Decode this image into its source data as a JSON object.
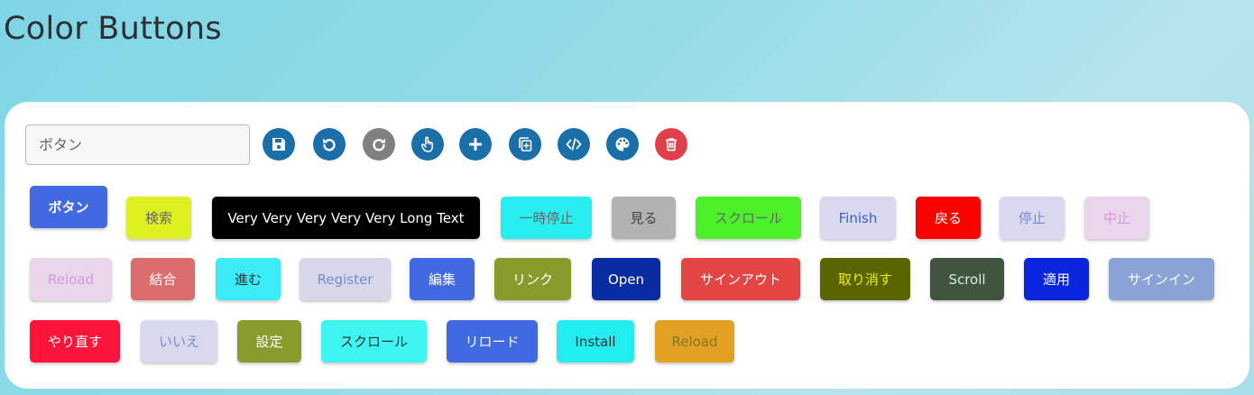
{
  "page": {
    "title": "Color Buttons"
  },
  "toolbar": {
    "input": {
      "placeholder": "ボタン",
      "value": ""
    },
    "icons": [
      {
        "name": "save-icon",
        "color": "#1a6fa8"
      },
      {
        "name": "undo-icon",
        "color": "#1a6fa8"
      },
      {
        "name": "redo-icon",
        "color": "#808080"
      },
      {
        "name": "hand-pointer-icon",
        "color": "#1a6fa8"
      },
      {
        "name": "plus-icon",
        "color": "#1a6fa8"
      },
      {
        "name": "copy-add-icon",
        "color": "#1a6fa8"
      },
      {
        "name": "code-icon",
        "color": "#1a6fa8"
      },
      {
        "name": "palette-icon",
        "color": "#1a6fa8"
      },
      {
        "name": "trash-icon",
        "color": "#e0404a"
      }
    ]
  },
  "rows": [
    [
      {
        "label": "ボタン",
        "bg": "#4169e1",
        "fg": "#ffffff",
        "bold": true
      },
      {
        "label": "検索",
        "bg": "#dff022",
        "fg": "#666666"
      },
      {
        "label": "Very Very Very Very Very Long Text",
        "bg": "#000000",
        "fg": "#ffffff"
      },
      {
        "label": "一時停止",
        "bg": "#28eeef",
        "fg": "#666666"
      },
      {
        "label": "見る",
        "bg": "#b2b2b2",
        "fg": "#444444"
      },
      {
        "label": "スクロール",
        "bg": "#4cf127",
        "fg": "#666666"
      },
      {
        "label": "Finish",
        "bg": "#d8d8ee",
        "fg": "#3a5fc8"
      },
      {
        "label": "戻る",
        "bg": "#fe0000",
        "fg": "#ffffff"
      },
      {
        "label": "停止",
        "bg": "#d8d8ee",
        "fg": "#7a8ad0"
      },
      {
        "label": "中止",
        "bg": "#ead6ea",
        "fg": "#d49ad8"
      }
    ],
    [
      {
        "label": "Reload",
        "bg": "#ead6ea",
        "fg": "#d49ad8"
      },
      {
        "label": "結合",
        "bg": "#dc6d6d",
        "fg": "#ffffff"
      },
      {
        "label": "進む",
        "bg": "#3cecf6",
        "fg": "#333333"
      },
      {
        "label": "Register",
        "bg": "#d6d8ea",
        "fg": "#7a8ad0"
      },
      {
        "label": "編集",
        "bg": "#4169e1",
        "fg": "#ffffff"
      },
      {
        "label": "リンク",
        "bg": "#8a9b2e",
        "fg": "#ffffff"
      },
      {
        "label": "Open",
        "bg": "#0a2ca1",
        "fg": "#ffffff"
      },
      {
        "label": "サインアウト",
        "bg": "#e34444",
        "fg": "#ffffff"
      },
      {
        "label": "取り消す",
        "bg": "#5b6500",
        "fg": "#f0f000"
      },
      {
        "label": "Scroll",
        "bg": "#415440",
        "fg": "#d8f0d8"
      },
      {
        "label": "適用",
        "bg": "#0b25df",
        "fg": "#ffffff"
      },
      {
        "label": "サインイン",
        "bg": "#8aa2d6",
        "fg": "#ffffff"
      }
    ],
    [
      {
        "label": "やり直す",
        "bg": "#fc143a",
        "fg": "#ffffff"
      },
      {
        "label": "いいえ",
        "bg": "#d8d8ee",
        "fg": "#7a8ad0"
      },
      {
        "label": "設定",
        "bg": "#8a9b2e",
        "fg": "#ffffff"
      },
      {
        "label": "スクロール",
        "bg": "#3ef5f0",
        "fg": "#333333"
      },
      {
        "label": "リロード",
        "bg": "#4169e1",
        "fg": "#ffffff"
      },
      {
        "label": "Install",
        "bg": "#22eef2",
        "fg": "#333333"
      },
      {
        "label": "Reload",
        "bg": "#e3a124",
        "fg": "#7a7a2a"
      }
    ]
  ]
}
